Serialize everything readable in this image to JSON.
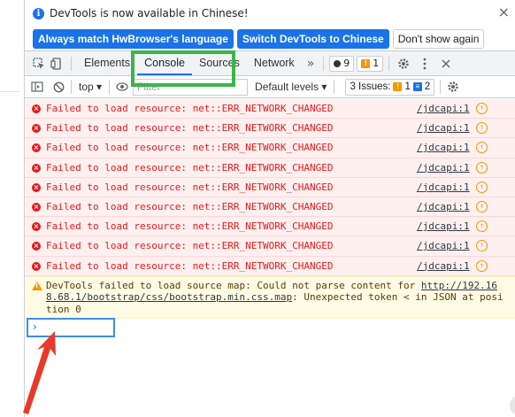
{
  "infobar": {
    "message": "DevTools is now available in Chinese!",
    "buttons": [
      "Always match HwBrowser's language",
      "Switch DevTools to Chinese",
      "Don't show again"
    ]
  },
  "tabs": {
    "items": [
      "Elements",
      "Console",
      "Sources",
      "Network"
    ],
    "active": "Console",
    "error_count": "9",
    "warning_count": "1"
  },
  "console_toolbar": {
    "context": "top",
    "filter_placeholder": "Filter",
    "levels": "Default levels",
    "issues_label": "3 Issues:",
    "issues_warning": "1",
    "issues_info": "2"
  },
  "messages": [
    {
      "text": "Failed to load resource: net::ERR_NETWORK_CHANGED",
      "source": "/jdcapi:1"
    },
    {
      "text": "Failed to load resource: net::ERR_NETWORK_CHANGED",
      "source": "/jdcapi:1"
    },
    {
      "text": "Failed to load resource: net::ERR_NETWORK_CHANGED",
      "source": "/jdcapi:1"
    },
    {
      "text": "Failed to load resource: net::ERR_NETWORK_CHANGED",
      "source": "/jdcapi:1"
    },
    {
      "text": "Failed to load resource: net::ERR_NETWORK_CHANGED",
      "source": "/jdcapi:1"
    },
    {
      "text": "Failed to load resource: net::ERR_NETWORK_CHANGED",
      "source": "/jdcapi:1"
    },
    {
      "text": "Failed to load resource: net::ERR_NETWORK_CHANGED",
      "source": "/jdcapi:1"
    },
    {
      "text": "Failed to load resource: net::ERR_NETWORK_CHANGED",
      "source": "/jdcapi:1"
    },
    {
      "text": "Failed to load resource: net::ERR_NETWORK_CHANGED",
      "source": "/jdcapi:1"
    }
  ],
  "warning": {
    "prefix": "DevTools failed to load source map: Could not parse content for ",
    "link": "http://192.168.68.1/bootstrap/css/bootstrap.min.css.map",
    "suffix": ": Unexpected token < in JSON at position 0"
  },
  "colors": {
    "highlight_tab": "#3ab54a",
    "highlight_prompt": "#3d8ee6",
    "arrow": "#e8392b"
  }
}
